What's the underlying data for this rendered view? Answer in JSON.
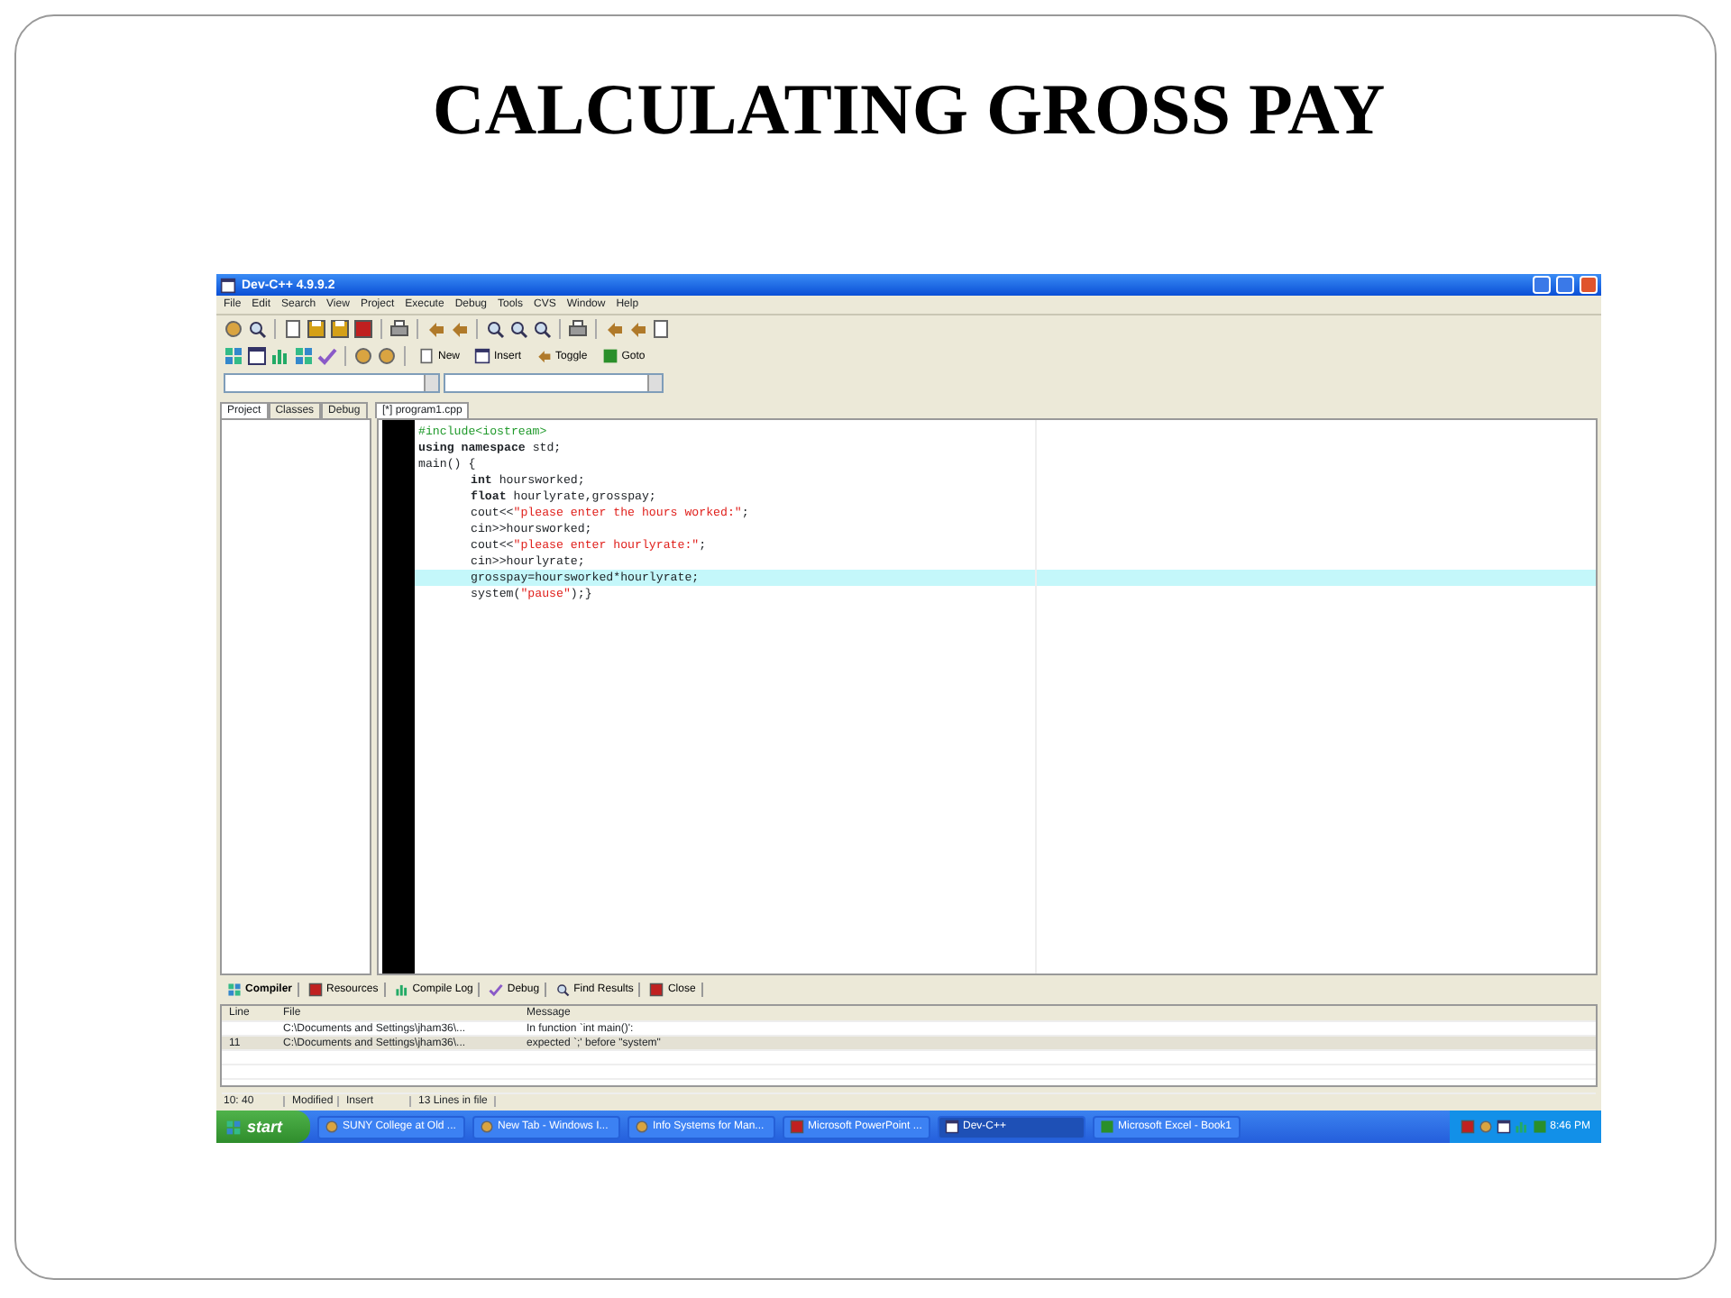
{
  "slide": {
    "title": "CALCULATING GROSS PAY"
  },
  "window": {
    "title": "Dev-C++ 4.9.9.2"
  },
  "menu": [
    "File",
    "Edit",
    "Search",
    "View",
    "Project",
    "Execute",
    "Debug",
    "Tools",
    "CVS",
    "Window",
    "Help"
  ],
  "toolbar_buttons": [
    "New",
    "Insert",
    "Toggle",
    "Goto"
  ],
  "project_tabs": [
    {
      "label": "Project",
      "selected": true
    },
    {
      "label": "Classes",
      "selected": false
    },
    {
      "label": "Debug",
      "selected": false
    }
  ],
  "editor_tabs": [
    {
      "label": "[*] program1.cpp",
      "selected": true
    }
  ],
  "code": [
    {
      "indented": false,
      "highlighted": false,
      "tokens": [
        {
          "kind": "preprocessor",
          "text": "#include<iostream>"
        }
      ]
    },
    {
      "indented": false,
      "highlighted": false,
      "tokens": [
        {
          "kind": "keyword",
          "text": "using namespace"
        },
        {
          "kind": "plain",
          "text": " std;"
        }
      ]
    },
    {
      "indented": false,
      "highlighted": false,
      "tokens": [
        {
          "kind": "plain",
          "text": "main() {"
        }
      ]
    },
    {
      "indented": true,
      "highlighted": false,
      "tokens": [
        {
          "kind": "keyword",
          "text": "int"
        },
        {
          "kind": "plain",
          "text": " hoursworked;"
        }
      ]
    },
    {
      "indented": true,
      "highlighted": false,
      "tokens": [
        {
          "kind": "keyword",
          "text": "float"
        },
        {
          "kind": "plain",
          "text": " hourlyrate,grosspay;"
        }
      ]
    },
    {
      "indented": true,
      "highlighted": false,
      "tokens": [
        {
          "kind": "plain",
          "text": "cout<<"
        },
        {
          "kind": "string",
          "text": "\"please enter the hours worked:\""
        },
        {
          "kind": "plain",
          "text": ";"
        }
      ]
    },
    {
      "indented": true,
      "highlighted": false,
      "tokens": [
        {
          "kind": "plain",
          "text": "cin>>hoursworked;"
        }
      ]
    },
    {
      "indented": true,
      "highlighted": false,
      "tokens": [
        {
          "kind": "plain",
          "text": "cout<<"
        },
        {
          "kind": "string",
          "text": "\"please enter hourlyrate:\""
        },
        {
          "kind": "plain",
          "text": ";"
        }
      ]
    },
    {
      "indented": true,
      "highlighted": false,
      "tokens": [
        {
          "kind": "plain",
          "text": "cin>>hourlyrate;"
        }
      ]
    },
    {
      "indented": true,
      "highlighted": true,
      "tokens": [
        {
          "kind": "plain",
          "text": "grosspay=hoursworked*hourlyrate;"
        }
      ]
    },
    {
      "indented": true,
      "highlighted": false,
      "tokens": [
        {
          "kind": "plain",
          "text": "system("
        },
        {
          "kind": "string",
          "text": "\"pause\""
        },
        {
          "kind": "plain",
          "text": ");}"
        }
      ]
    }
  ],
  "bottom_tabs": [
    {
      "label": "Compiler",
      "selected": true
    },
    {
      "label": "Resources",
      "selected": false
    },
    {
      "label": "Compile Log",
      "selected": false
    },
    {
      "label": "Debug",
      "selected": false
    },
    {
      "label": "Find Results",
      "selected": false
    },
    {
      "label": "Close",
      "selected": false
    }
  ],
  "messages": {
    "columns": [
      "Line",
      "File",
      "Message"
    ],
    "rows": [
      {
        "selected": false,
        "cells": [
          "",
          "C:\\Documents and Settings\\jham36\\...",
          "In function `int main()':"
        ]
      },
      {
        "selected": true,
        "cells": [
          "11",
          "C:\\Documents and Settings\\jham36\\...",
          "expected `;' before \"system\""
        ]
      }
    ]
  },
  "status_bar": [
    "10: 40",
    "Modified",
    "Insert",
    "13 Lines in file"
  ],
  "taskbar": {
    "start": "start",
    "tasks": [
      {
        "label": "SUNY College at Old ...",
        "selected": false
      },
      {
        "label": "New Tab - Windows I...",
        "selected": false
      },
      {
        "label": "Info Systems for Man...",
        "selected": false
      },
      {
        "label": "Microsoft PowerPoint ...",
        "selected": false
      },
      {
        "label": "Dev-C++",
        "selected": true
      },
      {
        "label": "Microsoft Excel - Book1",
        "selected": false
      }
    ],
    "clock": "8:46 PM"
  }
}
